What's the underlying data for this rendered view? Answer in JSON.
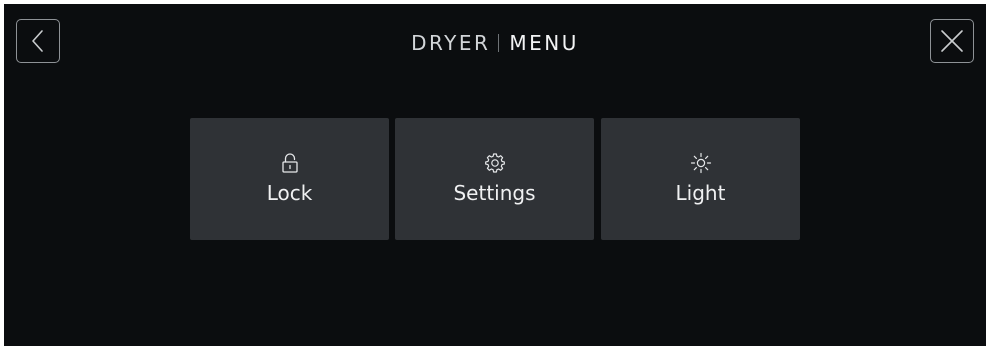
{
  "header": {
    "appliance": "DRYER",
    "section": "MENU"
  },
  "nav": {
    "back_icon": "chevron-left-icon",
    "close_icon": "close-icon"
  },
  "menu": {
    "tiles": [
      {
        "label": "Lock",
        "icon": "lock-icon"
      },
      {
        "label": "Settings",
        "icon": "gear-icon"
      },
      {
        "label": "Light",
        "icon": "sun-icon"
      }
    ]
  },
  "colors": {
    "background": "#0b0d0f",
    "tile": "#2f3236",
    "text": "#f0f1f2",
    "outline": "#8e9296"
  }
}
